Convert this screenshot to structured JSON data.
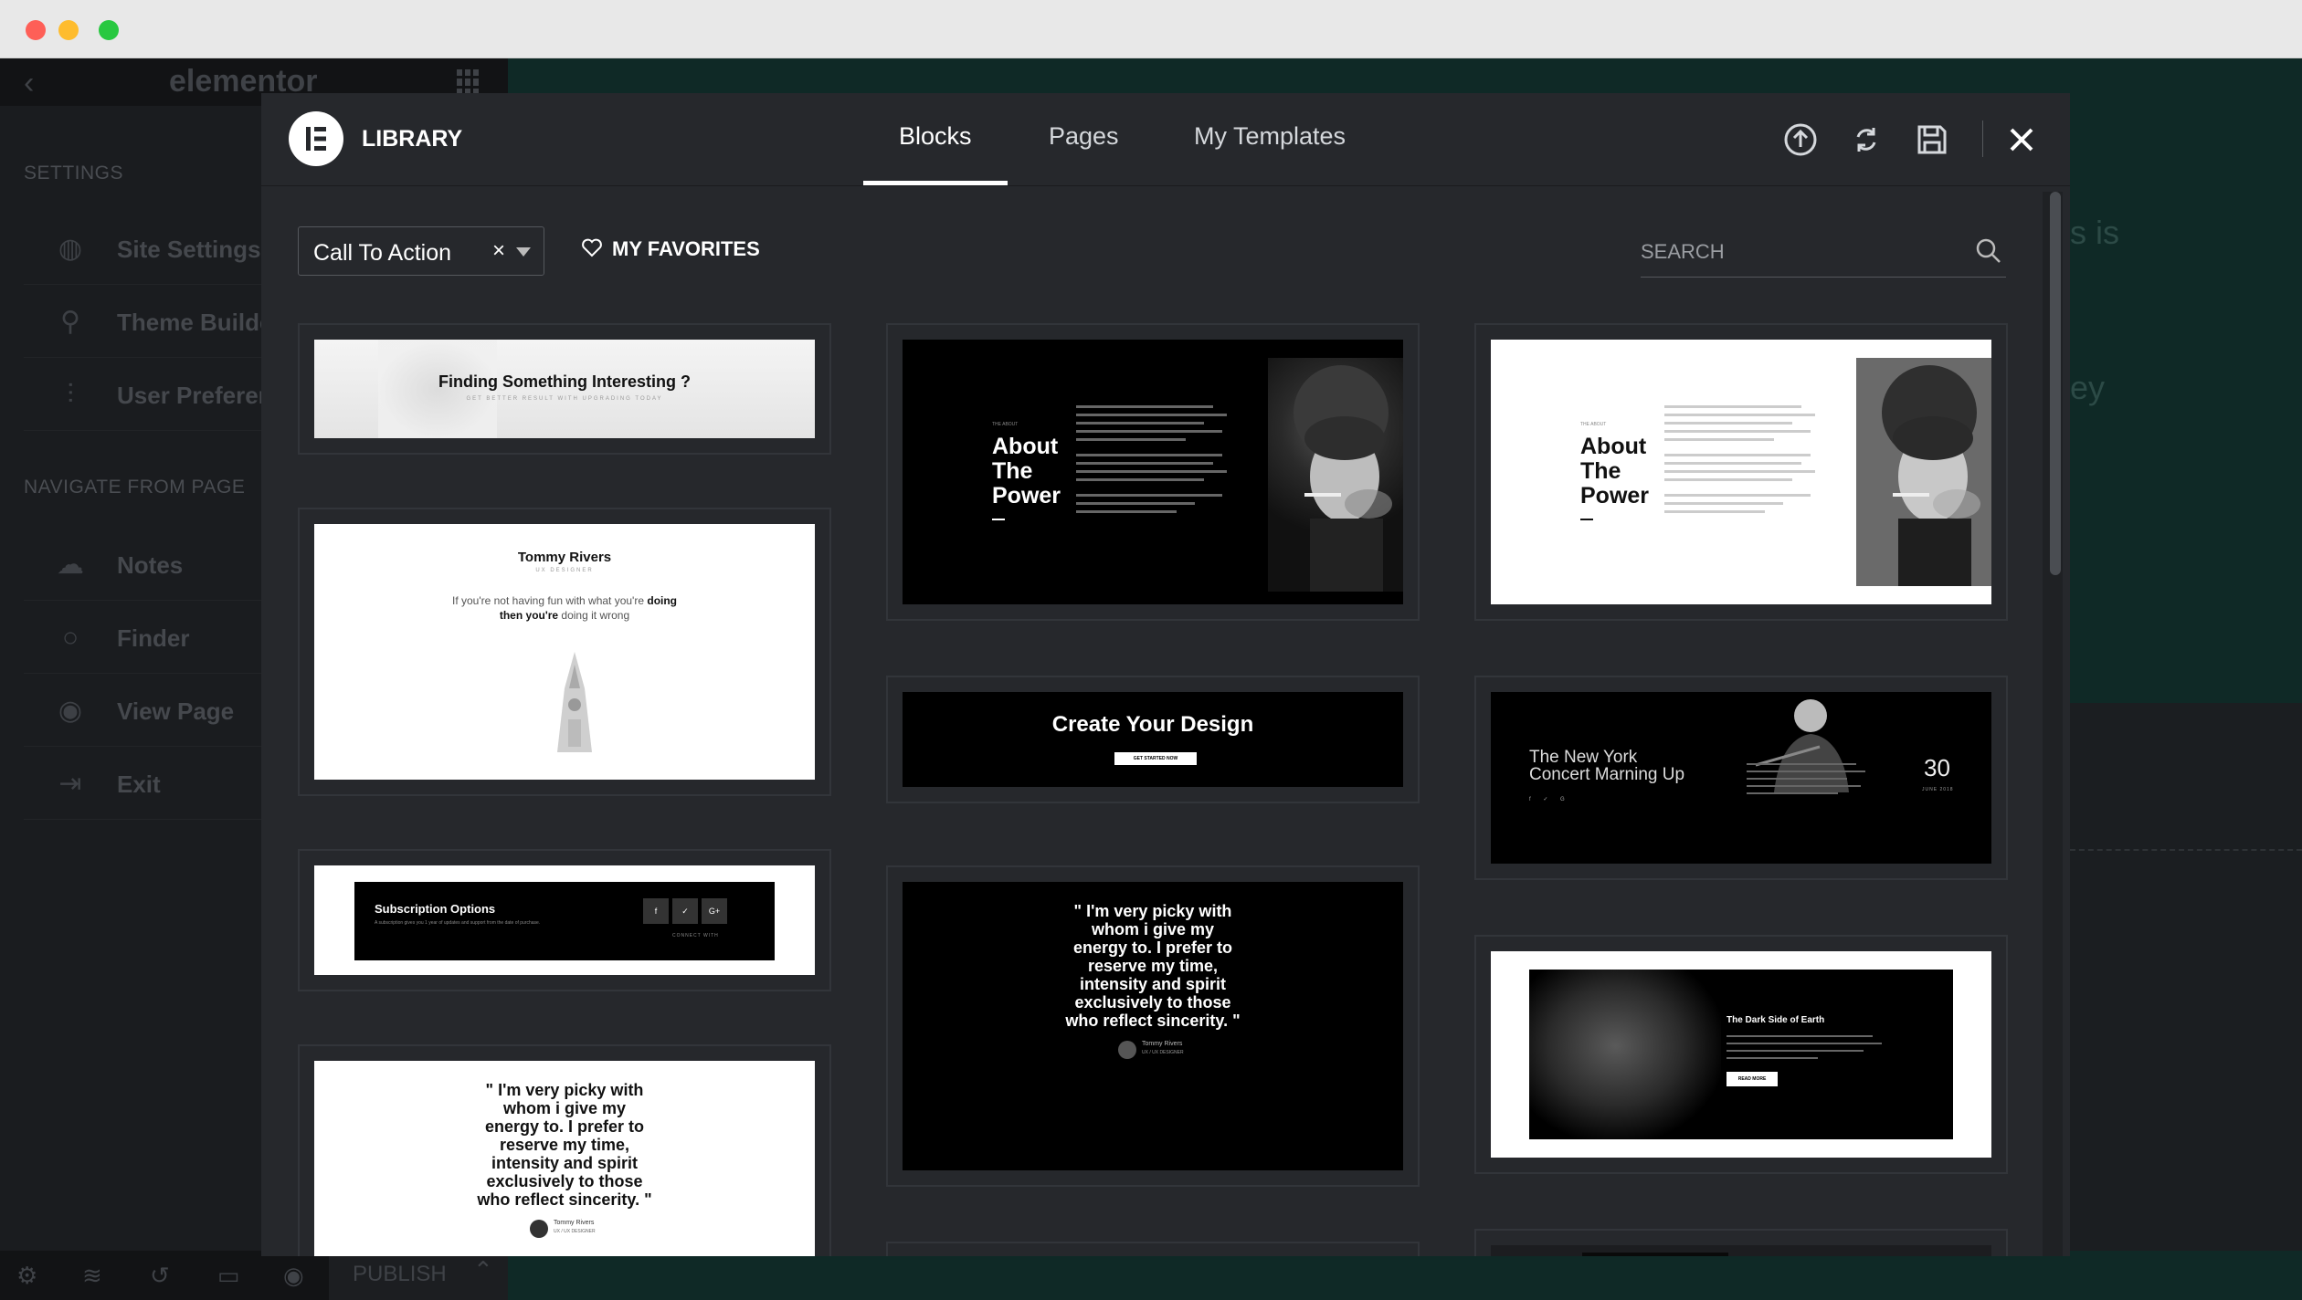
{
  "editor": {
    "brand": "elementor",
    "sections": {
      "settings": "SETTINGS",
      "navigate": "NAVIGATE FROM PAGE"
    },
    "settings_items": [
      {
        "label": "Site Settings",
        "icon": "globe-icon"
      },
      {
        "label": "Theme Builde",
        "icon": "sitemap-icon"
      },
      {
        "label": "User Preferen",
        "icon": "sliders-icon"
      }
    ],
    "navigate_items": [
      {
        "label": "Notes",
        "icon": "chat-icon"
      },
      {
        "label": "Finder",
        "icon": "search-icon"
      },
      {
        "label": "View Page",
        "icon": "eye-icon"
      },
      {
        "label": "Exit",
        "icon": "exit-icon"
      }
    ],
    "publish_label": "PUBLISH",
    "bg_text": [
      "s is",
      "ey"
    ]
  },
  "library": {
    "title": "LIBRARY",
    "tabs": [
      {
        "label": "Blocks",
        "active": true
      },
      {
        "label": "Pages",
        "active": false
      },
      {
        "label": "My Templates",
        "active": false
      }
    ],
    "header_icons": [
      "upload-icon",
      "sync-icon",
      "save-icon",
      "close-icon"
    ],
    "category_value": "Call To Action",
    "favorites_label": "MY FAVORITES",
    "search_placeholder": "SEARCH"
  },
  "cards": {
    "finding": {
      "title": "Finding Something Interesting ?",
      "sub": "GET BETTER RESULT WITH UPGRADING TODAY"
    },
    "tommy": {
      "name": "Tommy Rivers",
      "role": "UX DESIGNER",
      "quote_pre": "If you're not having fun with what you're ",
      "quote_bold1": "doing then",
      "quote_bold2": "you're",
      "quote_post": " doing it wrong"
    },
    "subscription": {
      "title": "Subscription Options",
      "sub": "A subscription gives you 1 year of updates and support from the date of purchase.",
      "connect": "CONNECT WITH",
      "socials": [
        "f",
        "✓",
        "G+"
      ]
    },
    "quote": {
      "text": "\" I'm very picky with whom i give my energy to. I prefer to reserve my time, intensity and spirit exclusively to those who reflect sincerity. \"",
      "name": "Tommy Rivers",
      "role": "UX / UX DESIGNER"
    },
    "about": {
      "eyebrow": "THE ABOUT",
      "title_line1": "About",
      "title_line2": "The",
      "title_line3": "Power"
    },
    "create": {
      "title": "Create Your Design",
      "button": "GET STARTED NOW"
    },
    "newyork": {
      "title_line1": "The New York",
      "title_line2": "Concert Marning Up",
      "day": "30",
      "month": "JUNE 2018"
    },
    "darkside": {
      "title": "The Dark Side of Earth",
      "button": "READ MORE"
    }
  }
}
